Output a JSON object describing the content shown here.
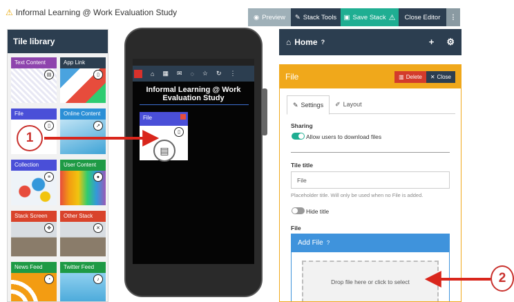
{
  "app": {
    "title": "Informal Learning @ Work Evaluation Study"
  },
  "toolbar": {
    "preview": "Preview",
    "stack_tools": "Stack Tools",
    "save_stack": "Save Stack",
    "close_editor": "Close Editor",
    "more": "⋮"
  },
  "tile_library": {
    "title": "Tile library",
    "tiles": [
      {
        "label": "Text Content",
        "color": "#8e44ad"
      },
      {
        "label": "App Link",
        "color": "#2c3e50"
      },
      {
        "label": "File",
        "color": "#4a4fd8"
      },
      {
        "label": "Online Content",
        "color": "#2b8fd6"
      },
      {
        "label": "Collection",
        "color": "#4a4fd8"
      },
      {
        "label": "User Content",
        "color": "#1e9a45"
      },
      {
        "label": "Stack Screen",
        "color": "#d9432b"
      },
      {
        "label": "Other Stack",
        "color": "#d9432b"
      },
      {
        "label": "News Feed",
        "color": "#1e9a45"
      },
      {
        "label": "Twitter Feed",
        "color": "#1e9a45"
      }
    ]
  },
  "phone": {
    "title": "Informal Learning @ Work Evaluation Study",
    "file_tile_label": "File"
  },
  "right_panel": {
    "home_label": "Home",
    "file_panel_title": "File",
    "delete_label": "Delete",
    "close_label": "Close",
    "tabs": {
      "settings": "Settings",
      "layout": "Layout"
    },
    "sharing_label": "Sharing",
    "allow_download_label": "Allow users to download files",
    "tile_title_label": "Tile title",
    "tile_title_value": "File",
    "tile_title_help": "Placeholder title. Will only be used when no File is added.",
    "hide_title_label": "Hide title",
    "file_label": "File",
    "add_file_label": "Add File",
    "dropzone_text": "Drop file here or click to select"
  },
  "callouts": {
    "one": "1",
    "two": "2"
  },
  "colors": {
    "accent_orange": "#f0a81b",
    "navy": "#2c3e50",
    "teal": "#1fae92",
    "red": "#c9302c",
    "blue": "#3f93dc"
  }
}
